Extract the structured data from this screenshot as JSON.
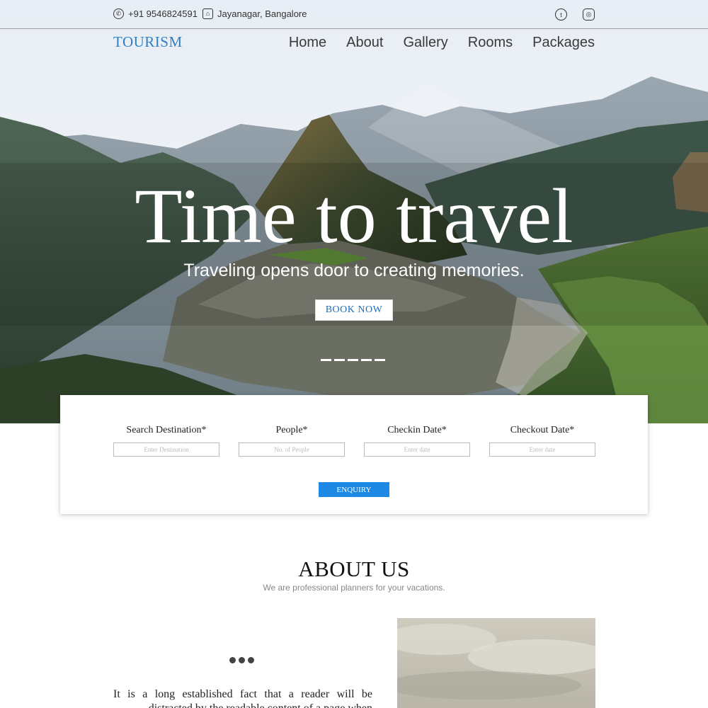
{
  "topbar": {
    "phone": "+91 9546824591",
    "location": "Jayanagar, Bangalore",
    "icons": [
      "phone-icon",
      "location-icon",
      "twitter-icon",
      "instagram-icon"
    ]
  },
  "brand": {
    "logo": "TOURISM"
  },
  "nav": {
    "items": [
      "Home",
      "About",
      "Gallery",
      "Rooms",
      "Packages"
    ]
  },
  "hero": {
    "title": "Time to travel",
    "subtitle": "Traveling opens door to creating memories.",
    "button": "BOOK NOW",
    "slide_count": 5
  },
  "search": {
    "fields": [
      {
        "label": "Search Destination*",
        "placeholder": "Enter Destination"
      },
      {
        "label": "People*",
        "placeholder": "No. of People"
      },
      {
        "label": "Checkin Date*",
        "placeholder": "Enter date"
      },
      {
        "label": "Checkout Date*",
        "placeholder": "Enter date"
      }
    ],
    "button": "ENQUIRY"
  },
  "about": {
    "title": "ABOUT US",
    "subtitle": "We are professional planners for your vacations.",
    "text": "It is a long established fact that a reader will be distracted by the readable content of a page when"
  },
  "colors": {
    "brand": "#2f7fc6",
    "enquiry": "#1e88e5"
  }
}
